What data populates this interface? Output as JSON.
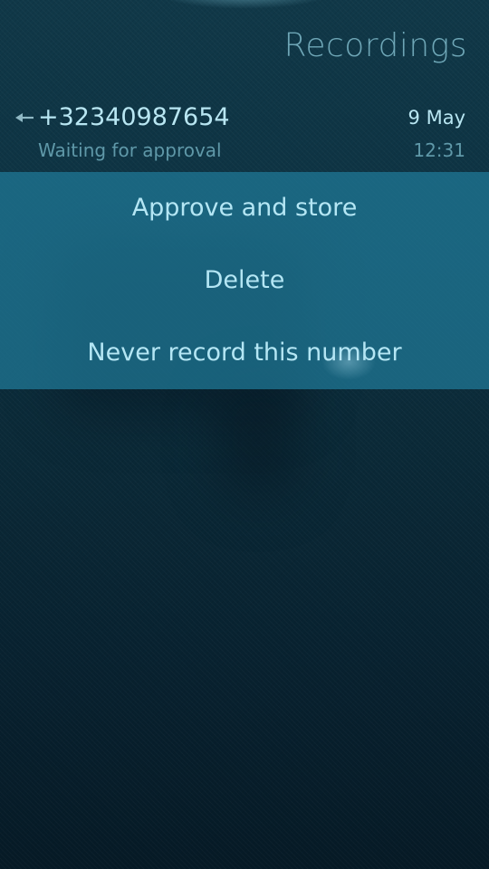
{
  "page": {
    "title": "Recordings"
  },
  "call": {
    "direction_icon": "arrow-left-icon",
    "number": "+32340987654",
    "status": "Waiting for approval",
    "date": "9 May",
    "time": "12:31"
  },
  "menu": {
    "items": [
      {
        "label": "Approve and store"
      },
      {
        "label": "Delete"
      },
      {
        "label": "Never record this number"
      }
    ]
  },
  "colors": {
    "accent": "#b8e6f2",
    "secondary": "#5f98a8",
    "menu_background": "#207a98"
  }
}
